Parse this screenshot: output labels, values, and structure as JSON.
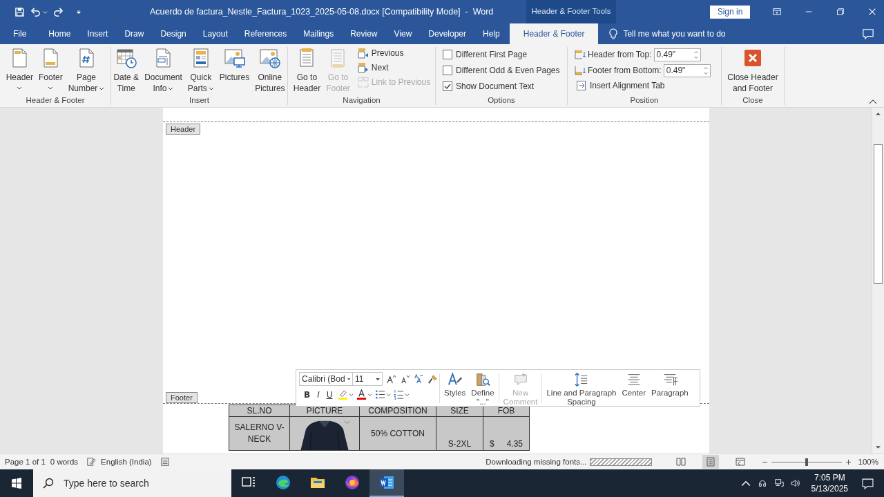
{
  "window": {
    "title": "Acuerdo de factura_Nestle_Factura_1023_2025-05-08.docx [Compatibility Mode]  -  Word",
    "tools_label": "Header & Footer Tools",
    "sign_in": "Sign in"
  },
  "tabs": [
    {
      "label": "File",
      "selected": false
    },
    {
      "label": "Home",
      "selected": false
    },
    {
      "label": "Insert",
      "selected": false
    },
    {
      "label": "Draw",
      "selected": false
    },
    {
      "label": "Design",
      "selected": false
    },
    {
      "label": "Layout",
      "selected": false
    },
    {
      "label": "References",
      "selected": false
    },
    {
      "label": "Mailings",
      "selected": false
    },
    {
      "label": "Review",
      "selected": false
    },
    {
      "label": "View",
      "selected": false
    },
    {
      "label": "Developer",
      "selected": false
    },
    {
      "label": "Help",
      "selected": false
    },
    {
      "label": "Header & Footer",
      "selected": true
    }
  ],
  "tell_me": {
    "placeholder": "Tell me what you want to do"
  },
  "ribbon": {
    "header_footer": {
      "label": "Header & Footer",
      "buttons": [
        {
          "lines": [
            "Header"
          ],
          "dropdown": true
        },
        {
          "lines": [
            "Footer"
          ],
          "dropdown": true
        },
        {
          "lines": [
            "Page",
            "Number"
          ],
          "dropdown": true
        }
      ]
    },
    "insert": {
      "label": "Insert",
      "buttons": [
        {
          "lines": [
            "Date &",
            "Time"
          ],
          "dropdown": false
        },
        {
          "lines": [
            "Document",
            "Info"
          ],
          "dropdown": true
        },
        {
          "lines": [
            "Quick",
            "Parts"
          ],
          "dropdown": true
        },
        {
          "lines": [
            "Pictures"
          ],
          "dropdown": false
        },
        {
          "lines": [
            "Online",
            "Pictures"
          ],
          "dropdown": false
        }
      ]
    },
    "navigation": {
      "label": "Navigation",
      "large_buttons": [
        {
          "lines": [
            "Go to",
            "Header"
          ],
          "disabled": false
        },
        {
          "lines": [
            "Go to",
            "Footer"
          ],
          "disabled": true
        }
      ],
      "small_buttons": [
        {
          "label": "Previous",
          "disabled": false
        },
        {
          "label": "Next",
          "disabled": false
        },
        {
          "label": "Link to Previous",
          "disabled": true
        }
      ]
    },
    "options": {
      "label": "Options",
      "checkboxes": [
        {
          "label": "Different First Page",
          "checked": false
        },
        {
          "label": "Different Odd & Even Pages",
          "checked": false
        },
        {
          "label": "Show Document Text",
          "checked": true
        }
      ]
    },
    "position": {
      "label": "Position",
      "spinners": [
        {
          "label": "Header from Top:",
          "value": "0.49\""
        },
        {
          "label": "Footer from Bottom:",
          "value": "0.49\""
        }
      ],
      "alignment_tab": "Insert Alignment Tab"
    },
    "close": {
      "label": "Close",
      "button_lines": [
        "Close Header",
        "and Footer"
      ]
    }
  },
  "document": {
    "header_tag": "Header",
    "footer_tag": "Footer",
    "table": {
      "columns": [
        "SL.NO",
        "PICTURE",
        "COMPOSITION",
        "SIZE",
        "FOB"
      ],
      "rows": [
        {
          "item": "SALERNO V-NECK",
          "composition": "50% COTTON",
          "size": "S-2XL",
          "fob_currency": "$",
          "fob_amount": "4.35"
        }
      ]
    }
  },
  "mini_toolbar": {
    "font": "Calibri (Bod",
    "size": "11",
    "format_buttons": [
      "B",
      "I",
      "U"
    ],
    "commands": [
      {
        "lines": [
          "Styles"
        ],
        "disabled": false
      },
      {
        "lines": [
          "Define",
          "\"...\""
        ],
        "disabled": false
      },
      {
        "lines": [
          "New",
          "Comment"
        ],
        "disabled": true
      },
      {
        "lines": [
          "Line and Paragraph",
          "Spacing"
        ],
        "disabled": false
      },
      {
        "lines": [
          "Center"
        ],
        "disabled": false
      },
      {
        "lines": [
          "Paragraph"
        ],
        "disabled": false
      }
    ]
  },
  "status_bar": {
    "page": "Page 1 of 1",
    "words": "0 words",
    "language": "English (India)",
    "progress_text": "Downloading missing fonts...",
    "progress": {
      "level": 1
    },
    "views": [
      {
        "selected": false
      },
      {
        "selected": true
      },
      {
        "selected": false
      }
    ],
    "zoom": {
      "level": 0.5,
      "label": "100%"
    }
  },
  "taskbar": {
    "search": {
      "placeholder": "Type here to search"
    },
    "apps": [
      {
        "selected": false
      },
      {
        "selected": false
      },
      {
        "selected": false
      },
      {
        "selected": false
      },
      {
        "selected": true
      }
    ],
    "time": "7:05 PM",
    "date": "5/13/2025"
  }
}
